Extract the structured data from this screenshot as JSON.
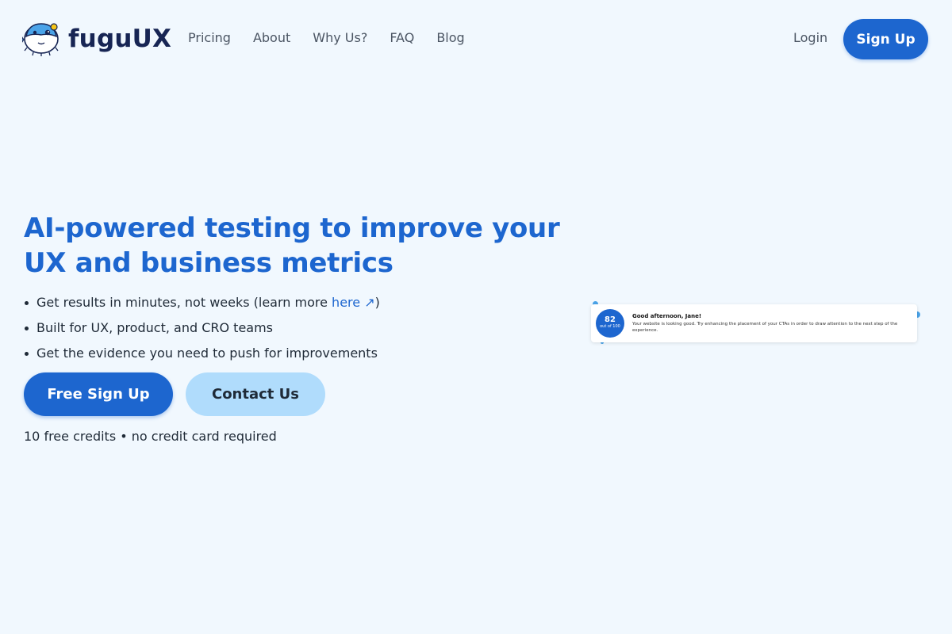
{
  "brand": {
    "name": "fuguUX",
    "logo_icon": "pufferfish-icon"
  },
  "nav": {
    "items": [
      "Pricing",
      "About",
      "Why Us?",
      "FAQ",
      "Blog"
    ]
  },
  "auth": {
    "login_label": "Login",
    "signup_label": "Sign Up"
  },
  "hero": {
    "title": "AI-powered testing to improve your UX and business metrics",
    "bullets": {
      "b1_text": "Get results in minutes, not weeks (learn more ",
      "b1_link": "here",
      "b1_link_icon": "external-arrow-icon",
      "b1_close": ")",
      "b2": "Built for UX, product, and CRO teams",
      "b3": "Get the evidence you need to push for improvements"
    },
    "primary_cta": "Free Sign Up",
    "secondary_cta": "Contact Us",
    "credits_note": "10 free credits • no credit card required"
  },
  "preview_card": {
    "score": "82",
    "score_sub": "out of 100",
    "greeting": "Good afternoon, Jane!",
    "message": "Your website is looking good. Try enhancing the placement of your CTAs in order to draw attention to the next step of the experience."
  },
  "colors": {
    "primary": "#1d66cf",
    "secondary": "#b0dcfc",
    "background": "#f1f8fe",
    "brand_text": "#172554"
  }
}
